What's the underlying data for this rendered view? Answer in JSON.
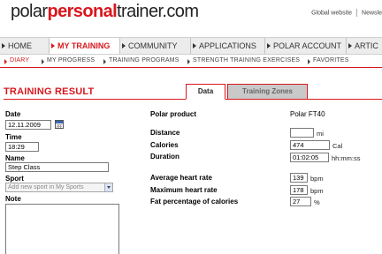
{
  "header": {
    "logo_prefix": "polar",
    "logo_brand": "personal",
    "logo_suffix": "trainer.com",
    "links": [
      "Global website",
      "Newsle"
    ]
  },
  "main_nav": {
    "items": [
      {
        "label": "HOME",
        "active": false
      },
      {
        "label": "MY TRAINING",
        "active": true
      },
      {
        "label": "COMMUNITY",
        "active": false
      },
      {
        "label": "APPLICATIONS",
        "active": false
      },
      {
        "label": "POLAR ACCOUNT",
        "active": false
      },
      {
        "label": "ARTIC",
        "active": false
      }
    ]
  },
  "sub_nav": {
    "items": [
      {
        "label": "DIARY",
        "active": true
      },
      {
        "label": "MY PROGRESS",
        "active": false
      },
      {
        "label": "TRAINING PROGRAMS",
        "active": false
      },
      {
        "label": "STRENGTH TRAINING EXERCISES",
        "active": false
      },
      {
        "label": "FAVORITES",
        "active": false
      }
    ]
  },
  "page": {
    "title": "TRAINING RESULT",
    "tabs": [
      {
        "label": "Data",
        "active": true
      },
      {
        "label": "Training Zones",
        "active": false
      }
    ]
  },
  "form_left": {
    "date_label": "Date",
    "date_value": "12.11.2009",
    "time_label": "Time",
    "time_value": "18:29",
    "name_label": "Name",
    "name_value": "Step Class",
    "sport_label": "Sport",
    "sport_value": "Add new sport in My Sports",
    "note_label": "Note",
    "note_value": ""
  },
  "form_right": {
    "product_label": "Polar product",
    "product_value": "Polar FT40",
    "distance_label": "Distance",
    "distance_value": "",
    "distance_unit": "mi",
    "calories_label": "Calories",
    "calories_value": "474",
    "calories_unit": "Cal",
    "duration_label": "Duration",
    "duration_value": "01:02:05",
    "duration_unit": "hh:mm:ss",
    "avg_hr_label": "Average heart rate",
    "avg_hr_value": "139",
    "avg_hr_unit": "bpm",
    "max_hr_label": "Maximum heart rate",
    "max_hr_value": "178",
    "max_hr_unit": "bpm",
    "fat_label": "Fat percentage of calories",
    "fat_value": "27",
    "fat_unit": "%"
  },
  "colors": {
    "accent": "#d8171d",
    "nav_bg": "#ececec",
    "inactive_tab_bg": "#c9c9c9"
  }
}
